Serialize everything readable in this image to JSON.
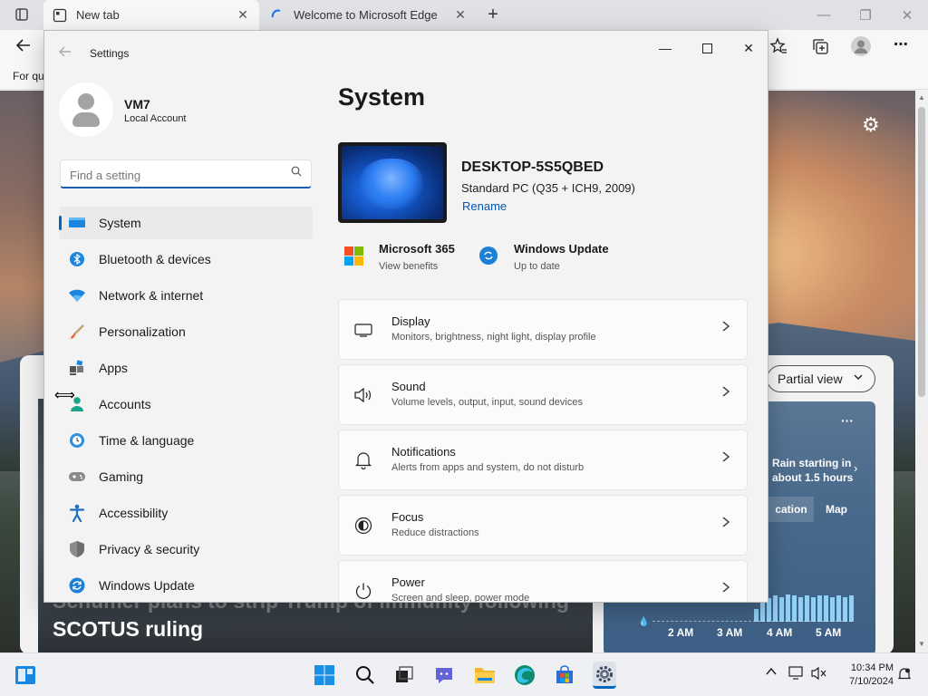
{
  "browser": {
    "tabs": [
      {
        "title": "New tab",
        "active": true
      },
      {
        "title": "Welcome to Microsoft Edge",
        "active": false
      }
    ],
    "favorites_bar_text": "For qu"
  },
  "newtab": {
    "partial_view_label": "Partial view",
    "news_headline_faded": "Schumer plans to strip Trump of immunity following",
    "news_headline": "SCOTUS ruling",
    "weather": {
      "rain_notice": "Rain starting in about 1.5 hours",
      "tab_location": "cation",
      "tab_map": "Map",
      "times": [
        "2 AM",
        "3 AM",
        "4 AM",
        "5 AM"
      ],
      "rain_levels": [
        0.45,
        0.8,
        0.85,
        0.95,
        0.9,
        1.0,
        0.95,
        0.9,
        0.95,
        0.9,
        0.95,
        0.95,
        0.9,
        0.95,
        0.9,
        0.95
      ]
    }
  },
  "settings": {
    "window_title": "Settings",
    "profile": {
      "name": "VM7",
      "account_type": "Local Account"
    },
    "search": {
      "placeholder": "Find a setting",
      "value": ""
    },
    "nav": [
      {
        "label": "System",
        "icon": "system-icon",
        "active": true
      },
      {
        "label": "Bluetooth & devices",
        "icon": "bluetooth-icon"
      },
      {
        "label": "Network & internet",
        "icon": "wifi-icon"
      },
      {
        "label": "Personalization",
        "icon": "brush-icon"
      },
      {
        "label": "Apps",
        "icon": "apps-icon"
      },
      {
        "label": "Accounts",
        "icon": "accounts-icon"
      },
      {
        "label": "Time & language",
        "icon": "clock-globe-icon"
      },
      {
        "label": "Gaming",
        "icon": "gamepad-icon"
      },
      {
        "label": "Accessibility",
        "icon": "accessibility-icon"
      },
      {
        "label": "Privacy & security",
        "icon": "shield-icon"
      },
      {
        "label": "Windows Update",
        "icon": "windows-update-icon"
      }
    ],
    "main": {
      "title": "System",
      "device": {
        "name": "DESKTOP-5S5QBED",
        "model": "Standard PC (Q35 + ICH9, 2009)",
        "rename_label": "Rename"
      },
      "promos": [
        {
          "title": "Microsoft 365",
          "subtitle": "View benefits",
          "icon": "microsoft-365-icon"
        },
        {
          "title": "Windows Update",
          "subtitle": "Up to date",
          "icon": "windows-update-icon"
        }
      ],
      "cards": [
        {
          "title": "Display",
          "subtitle": "Monitors, brightness, night light, display profile",
          "icon": "display-icon"
        },
        {
          "title": "Sound",
          "subtitle": "Volume levels, output, input, sound devices",
          "icon": "speaker-icon"
        },
        {
          "title": "Notifications",
          "subtitle": "Alerts from apps and system, do not disturb",
          "icon": "bell-icon"
        },
        {
          "title": "Focus",
          "subtitle": "Reduce distractions",
          "icon": "focus-icon"
        },
        {
          "title": "Power",
          "subtitle": "Screen and sleep, power mode",
          "icon": "power-icon"
        }
      ]
    }
  },
  "taskbar": {
    "time": "10:34 PM",
    "date": "7/10/2024"
  },
  "colors": {
    "accent": "#0067c0",
    "link": "#0055b3"
  }
}
